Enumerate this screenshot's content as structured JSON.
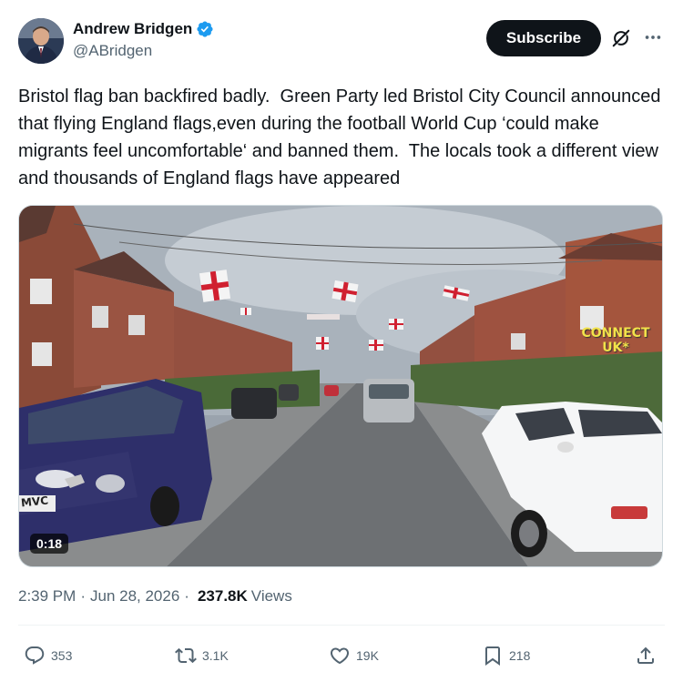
{
  "author": {
    "display_name": "Andrew Bridgen",
    "handle": "@ABridgen",
    "verified": true,
    "verified_color": "#1d9bf0"
  },
  "header_actions": {
    "subscribe_label": "Subscribe",
    "grok_icon": "grok-icon",
    "more_icon": "more-dots-icon"
  },
  "tweet": {
    "text": "Bristol flag ban backfired badly.  Green Party led Bristol City Council announced that flying England flags,even during the football World Cup ‘could make migrants feel uncomfortable‘ and banned them.  The locals took a different view and thousands of England flags have appeared"
  },
  "media": {
    "type": "video",
    "duration": "0:18",
    "watermark_line1": "CONNECT",
    "watermark_line2": "UK*",
    "car_plate": "MVC"
  },
  "meta": {
    "time": "2:39 PM",
    "separator1": "·",
    "date": "Jun 28, 2026",
    "separator2": "·",
    "views_count": "237.8K",
    "views_label": "Views"
  },
  "engagement": {
    "replies": "353",
    "reposts": "3.1K",
    "likes": "19K",
    "bookmarks": "218"
  },
  "colors": {
    "text_primary": "#0f1419",
    "text_secondary": "#536471",
    "divider": "#eff3f4",
    "subscribe_bg": "#0f1419"
  }
}
